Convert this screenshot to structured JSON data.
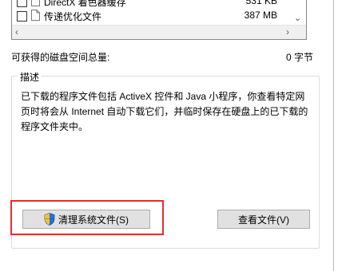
{
  "file_list": {
    "items": [
      {
        "name": "DirectX 着色器缓存",
        "size": "531 KB",
        "checked": false
      },
      {
        "name": "传递优化文件",
        "size": "387 MB",
        "checked": false
      }
    ]
  },
  "disk_space": {
    "label": "可获得的磁盘空间总量:",
    "value": "0 字节"
  },
  "description": {
    "legend": "描述",
    "text": "已下载的程序文件包括 ActiveX 控件和 Java 小程序，你查看特定网页时将会从 Internet 自动下载它们，并临时保存在硬盘上的已下载的程序文件夹中。"
  },
  "buttons": {
    "clean_system": "清理系统文件(S)",
    "view_files": "查看文件(V)"
  },
  "colors": {
    "highlight_border": "#e0302f",
    "button_bg": "#e1e1e1"
  }
}
